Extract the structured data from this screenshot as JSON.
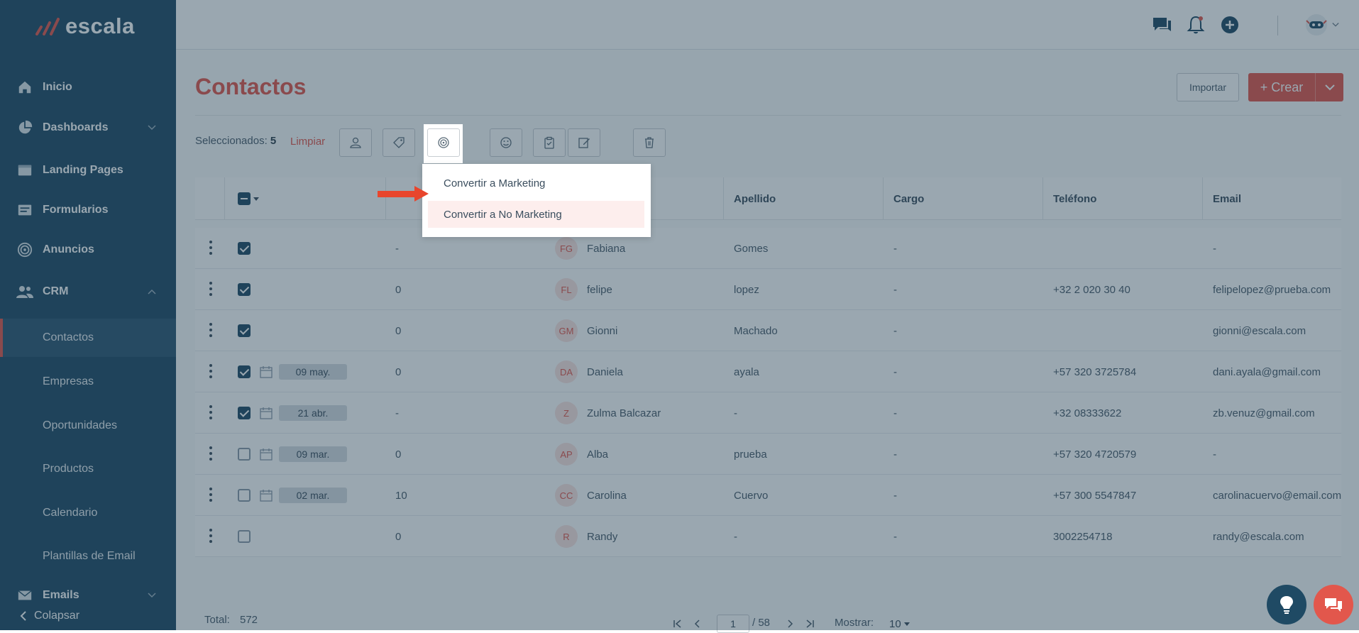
{
  "brand": {
    "name": "escala"
  },
  "sidebar": {
    "items": [
      {
        "label": "Inicio"
      },
      {
        "label": "Dashboards"
      },
      {
        "label": "Landing Pages"
      },
      {
        "label": "Formularios"
      },
      {
        "label": "Anuncios"
      },
      {
        "label": "CRM"
      },
      {
        "label": "Emails"
      }
    ],
    "crm_sub": [
      {
        "label": "Contactos"
      },
      {
        "label": "Empresas"
      },
      {
        "label": "Oportunidades"
      },
      {
        "label": "Productos"
      },
      {
        "label": "Calendario"
      },
      {
        "label": "Plantillas de Email"
      }
    ],
    "collapse_label": "Colapsar"
  },
  "page": {
    "title": "Contactos"
  },
  "header_actions": {
    "import_label": "Importar",
    "create_label": "+ Crear"
  },
  "selection": {
    "label": "Seleccionados:",
    "count": "5",
    "clear_label": "Limpiar"
  },
  "dropdown": {
    "items": [
      "Convertir a Marketing",
      "Convertir a No Marketing"
    ]
  },
  "table": {
    "columns": [
      "Apellido",
      "Cargo",
      "Teléfono",
      "Email"
    ],
    "rows": [
      {
        "checked": true,
        "date": "",
        "score": "-",
        "initials": "FG",
        "name": "Fabiana",
        "last": "Gomes",
        "role": "-",
        "phone": "",
        "email": "-"
      },
      {
        "checked": true,
        "date": "",
        "score": "0",
        "initials": "FL",
        "name": "felipe",
        "last": "lopez",
        "role": "-",
        "phone": "+32 2 020 30 40",
        "email": "felipelopez@prueba.com"
      },
      {
        "checked": true,
        "date": "",
        "score": "0",
        "initials": "GM",
        "name": "Gionni",
        "last": "Machado",
        "role": "-",
        "phone": "",
        "email": "gionni@escala.com"
      },
      {
        "checked": true,
        "date": "09 may.",
        "score": "0",
        "initials": "DA",
        "name": "Daniela",
        "last": "ayala",
        "role": "-",
        "phone": "+57 320 3725784",
        "email": "dani.ayala@gmail.com"
      },
      {
        "checked": true,
        "date": "21 abr.",
        "score": "-",
        "initials": "Z",
        "name": "Zulma Balcazar",
        "last": "-",
        "role": "-",
        "phone": "+32 08333622",
        "email": "zb.venuz@gmail.com"
      },
      {
        "checked": false,
        "date": "09 mar.",
        "score": "0",
        "initials": "AP",
        "name": "Alba",
        "last": "prueba",
        "role": "-",
        "phone": "+57 320 4720579",
        "email": "-"
      },
      {
        "checked": false,
        "date": "02 mar.",
        "score": "10",
        "initials": "CC",
        "name": "Carolina",
        "last": "Cuervo",
        "role": "-",
        "phone": "+57 300 5547847",
        "email": "carolinacuervo@email.com"
      },
      {
        "checked": false,
        "date": "",
        "score": "0",
        "initials": "R",
        "name": "Randy",
        "last": "-",
        "role": "-",
        "phone": "3002254718",
        "email": "randy@escala.com"
      }
    ]
  },
  "footer": {
    "total_label": "Total:",
    "total": "572",
    "page": "1",
    "pages": "/ 58",
    "show_label": "Mostrar:",
    "show_value": "10"
  },
  "colors": {
    "primary": "#1f4a64",
    "accent": "#e2574c"
  }
}
